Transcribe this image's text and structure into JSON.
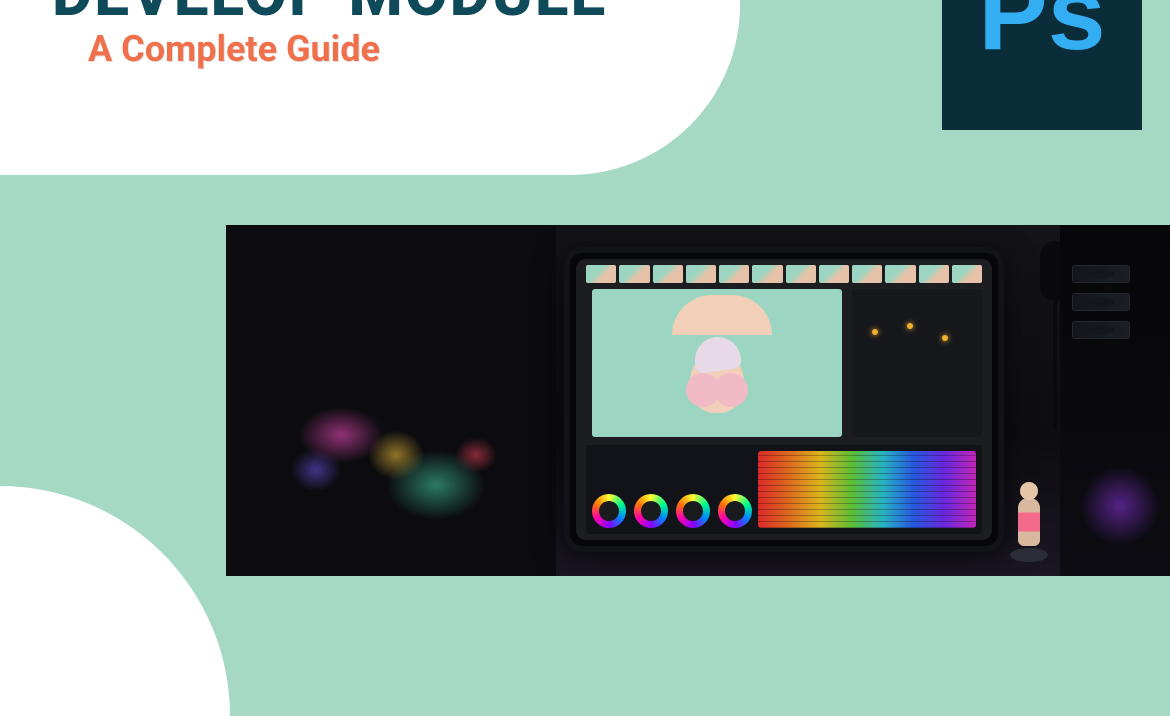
{
  "header": {
    "title_partial": "DEVELOP MODULE",
    "subtitle": "A Complete Guide"
  },
  "app_badge": {
    "label": "Ps",
    "name": "photoshop-icon"
  },
  "colors": {
    "background": "#a6d9c4",
    "accent": "#f0704b",
    "title": "#0e4a5a",
    "ps_bg": "#0b2d3a",
    "ps_fg": "#33aef2"
  }
}
